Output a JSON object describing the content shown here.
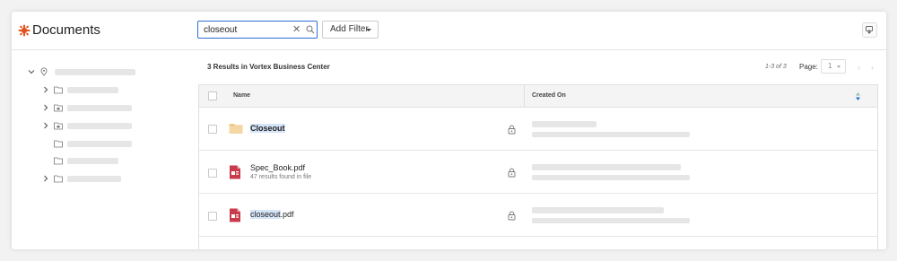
{
  "header": {
    "title": "Documents",
    "accent_color": "#e0521f"
  },
  "search": {
    "value": "closeout",
    "clear_icon": "close-icon",
    "search_icon": "search-icon"
  },
  "filter": {
    "label": "Add Filter"
  },
  "results": {
    "summary": "3 Results in Vortex Business Center",
    "range": "1-3 of 3",
    "page_label": "Page:",
    "page_value": "1"
  },
  "table": {
    "columns": {
      "name": "Name",
      "created_on": "Created On"
    },
    "rows": [
      {
        "name_highlight": "Closeout",
        "name_rest": "",
        "type": "folder",
        "subtitle": ""
      },
      {
        "name_highlight": "",
        "name_rest": "Spec_Book.pdf",
        "type": "pdf",
        "subtitle": "47 results found in file"
      },
      {
        "name_highlight": "closeout",
        "name_rest": ".pdf",
        "type": "pdf",
        "subtitle": ""
      }
    ]
  },
  "colors": {
    "folder": "#f1c88b",
    "pdf": "#c93a4b",
    "search_border": "#2b6fd6",
    "highlight": "#d6e4f7"
  }
}
